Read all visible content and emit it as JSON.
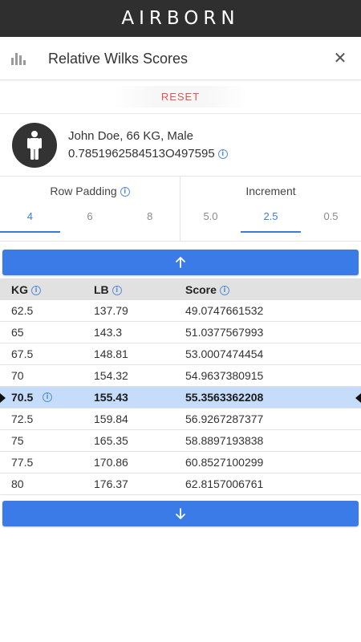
{
  "app": {
    "brand": "AIRBORN"
  },
  "header": {
    "title": "Relative Wilks Scores",
    "chart_icon": "bar-chart-icon",
    "close_icon": "close-icon",
    "close_glyph": "✕"
  },
  "reset": {
    "label": "RESET"
  },
  "profile": {
    "name_line": "John Doe, 66 KG, Male",
    "coefficient": "0.7851962584513O497595",
    "avatar_icon": "person-icon"
  },
  "options": {
    "row_padding": {
      "label": "Row Padding",
      "values": [
        "4",
        "6",
        "8"
      ],
      "selected": "4"
    },
    "increment": {
      "label": "Increment",
      "values": [
        "5.0",
        "2.5",
        "0.5"
      ],
      "selected": "2.5"
    }
  },
  "table": {
    "headers": {
      "kg": "KG",
      "lb": "LB",
      "score": "Score"
    },
    "rows": [
      {
        "kg": "62.5",
        "lb": "137.79",
        "score": "49.0747661532"
      },
      {
        "kg": "65",
        "lb": "143.3",
        "score": "51.0377567993"
      },
      {
        "kg": "67.5",
        "lb": "148.81",
        "score": "53.0007474454"
      },
      {
        "kg": "70",
        "lb": "154.32",
        "score": "54.9637380915"
      },
      {
        "kg": "70.5",
        "lb": "155.43",
        "score": "55.3563362208",
        "selected": true
      },
      {
        "kg": "72.5",
        "lb": "159.84",
        "score": "56.9267287377"
      },
      {
        "kg": "75",
        "lb": "165.35",
        "score": "58.8897193838"
      },
      {
        "kg": "77.5",
        "lb": "170.86",
        "score": "60.8527100299"
      },
      {
        "kg": "80",
        "lb": "176.37",
        "score": "62.8157006761"
      }
    ]
  },
  "colors": {
    "accent": "#3a7be8",
    "reset": "#e05555",
    "selected_row": "#c5dcfb",
    "brand_bar": "#2f2f2f"
  }
}
